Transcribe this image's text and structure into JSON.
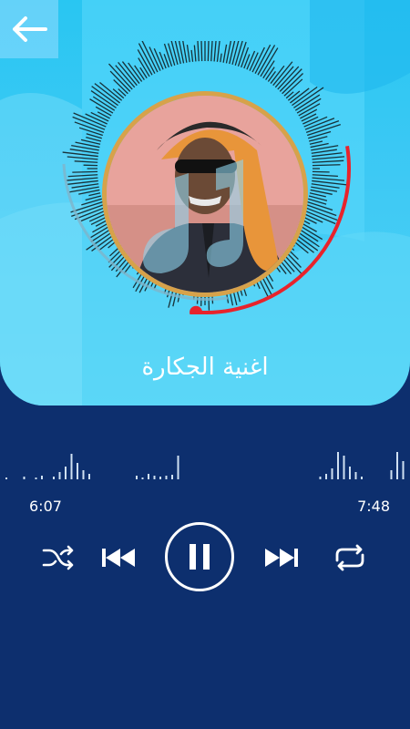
{
  "header": {
    "back_icon": "back-arrow-icon"
  },
  "song": {
    "title": "اغنية الجكارة"
  },
  "player": {
    "current_time": "6:07",
    "total_time": "7:48",
    "progress": 0.786,
    "state": "playing"
  },
  "controls": {
    "shuffle_icon": "shuffle-icon",
    "previous_icon": "skip-previous-icon",
    "pause_icon": "pause-icon",
    "next_icon": "skip-next-icon",
    "repeat_icon": "repeat-icon"
  },
  "colors": {
    "background": "#0d2f6e",
    "hero": "#3ec9f4",
    "progress": "#e8232b",
    "text": "#ffffff"
  }
}
